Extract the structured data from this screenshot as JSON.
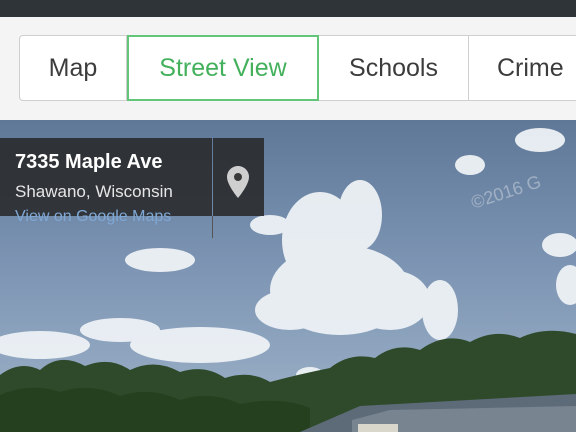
{
  "tabs": [
    {
      "label": "Map",
      "active": false
    },
    {
      "label": "Street View",
      "active": true
    },
    {
      "label": "Schools",
      "active": false
    },
    {
      "label": "Crime",
      "active": false
    }
  ],
  "address": {
    "street": "7335 Maple Ave",
    "city": "Shawano, Wisconsin",
    "link": "View on Google Maps"
  },
  "watermark": "©2016 G",
  "colors": {
    "accent": "#43b05c",
    "top_bar": "#2e3437",
    "sky": "#6f88a8",
    "overlay": "#262626"
  },
  "icons": {
    "pin": "map-pin-icon"
  }
}
